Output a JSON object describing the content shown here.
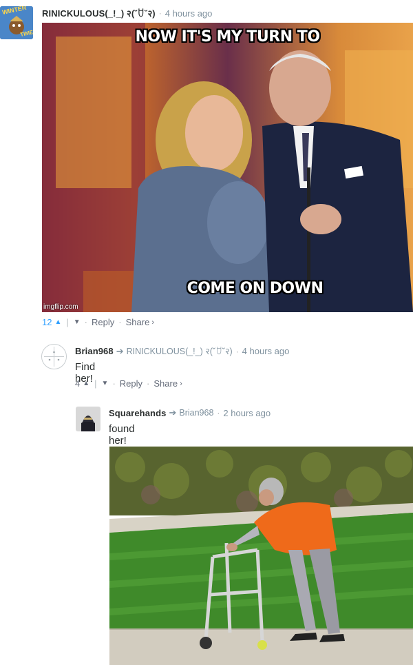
{
  "comments": [
    {
      "author": "RINICKULOUS(_!_) २(˘ꇴ˘२)",
      "time": "4 hours ago",
      "meme": {
        "top_text": "NOW IT'S MY TURN TO",
        "bottom_text": "COME ON DOWN",
        "watermark": "imgflip.com"
      },
      "votes": "12",
      "reply_label": "Reply",
      "share_label": "Share",
      "avatar_text": "WINTER TIME"
    },
    {
      "author": "Brian968",
      "reply_to": "RINICKULOUS(_!_) २(˘ꇴ˘२)",
      "time": "4 hours ago",
      "text": "Find her!",
      "votes": "4",
      "reply_label": "Reply",
      "share_label": "Share"
    },
    {
      "author": "Squarehands",
      "reply_to": "Brian968",
      "time": "2 hours ago",
      "text": "found her!"
    }
  ],
  "icons": {
    "reply_arrow": "reply-arrow-icon",
    "upvote": "chevron-up-icon",
    "downvote": "chevron-down-icon",
    "share_chevron": "chevron-right-icon"
  },
  "colors": {
    "accent": "#2e9fff",
    "muted": "#656c7a",
    "meta": "#7f919e"
  }
}
